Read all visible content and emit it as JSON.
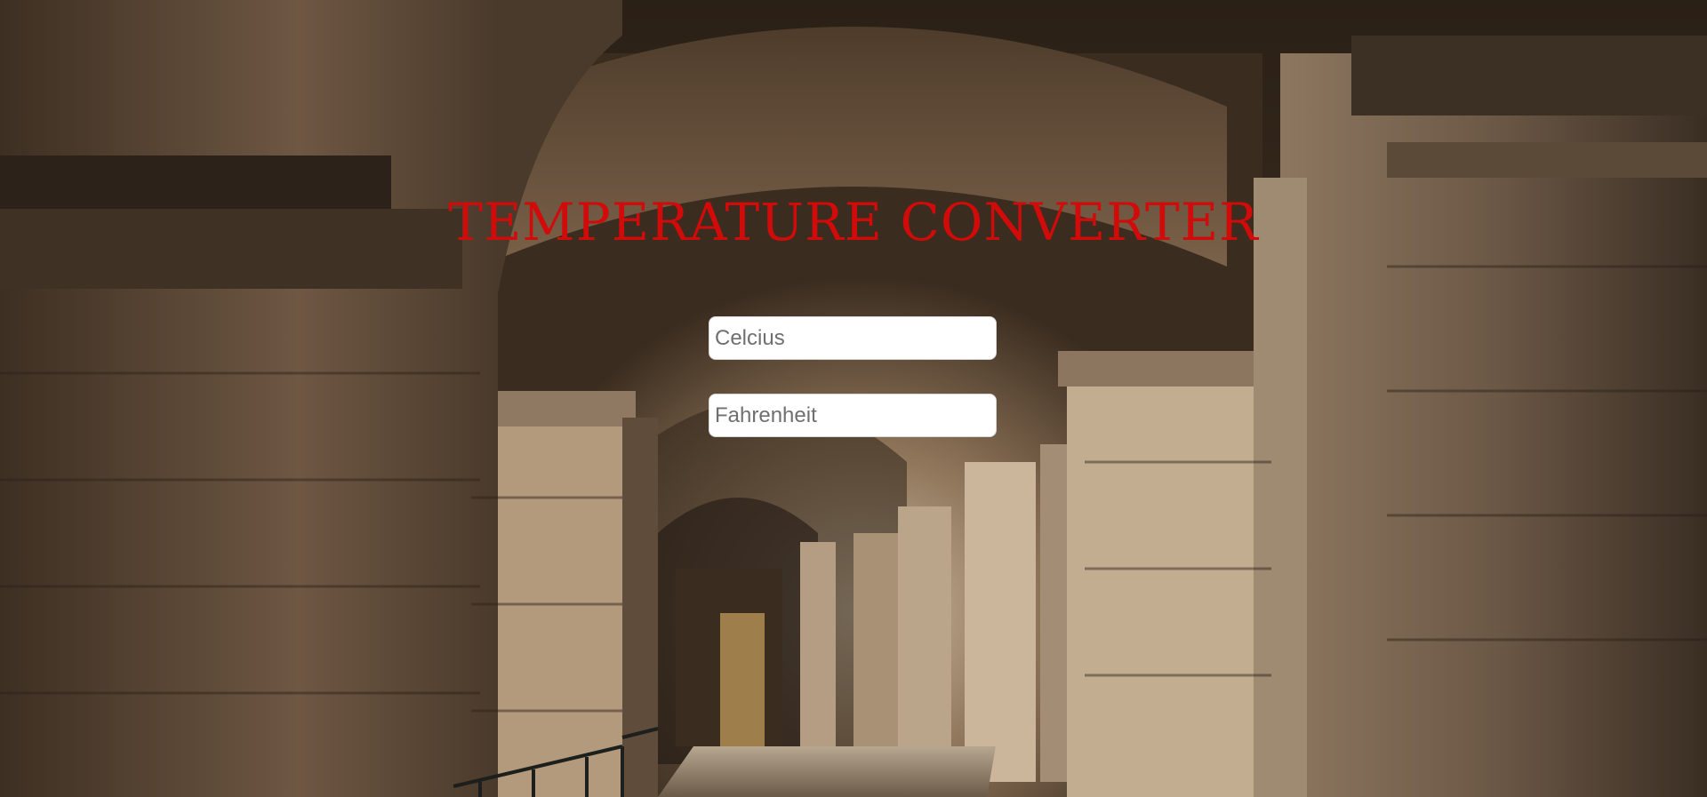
{
  "title": "TEMPERATURE CONVERTER",
  "inputs": {
    "celsius": {
      "placeholder": "Celcius",
      "value": ""
    },
    "fahrenheit": {
      "placeholder": "Fahrenheit",
      "value": ""
    }
  },
  "colors": {
    "title": "#d10a0a",
    "input_background": "#ffffff",
    "placeholder": "#6f6f6f"
  },
  "background": {
    "icon": "colosseum-archway-photo"
  }
}
